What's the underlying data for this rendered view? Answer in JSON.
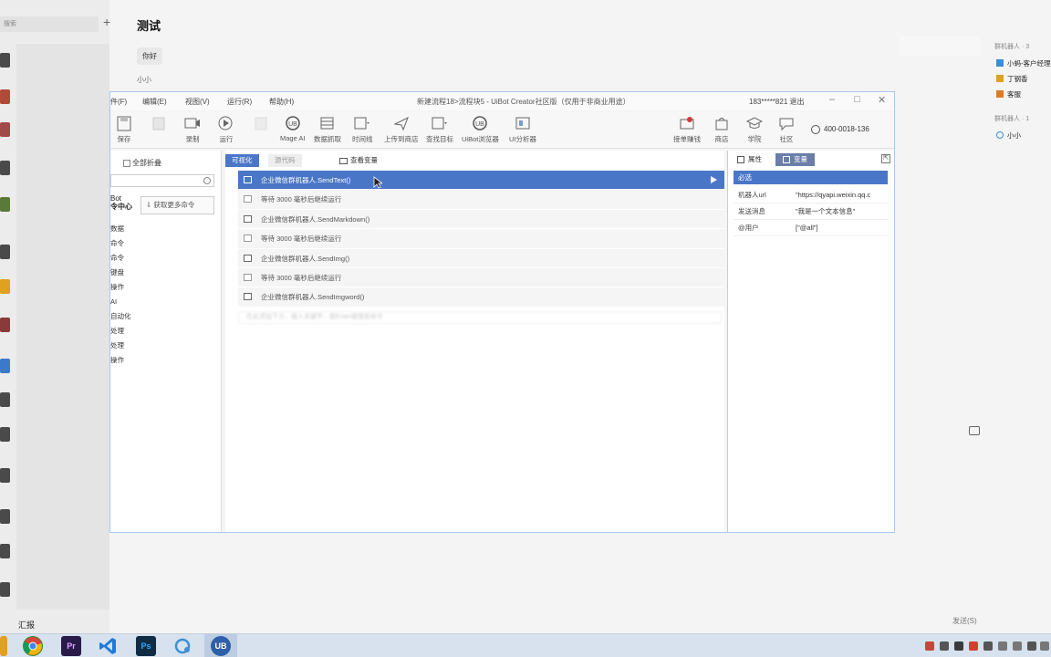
{
  "chat": {
    "search_placeholder": "搜索",
    "title": "测试",
    "bubble": "你好",
    "sender": "小小",
    "report": "汇报",
    "send": "发送(S)",
    "right_list": {
      "bots_header": "群机器人 · 3",
      "bots": [
        "小蚂-客户经理",
        "丁钢香",
        "客服"
      ],
      "people_header": "群机器人 · 1",
      "people": [
        "小小"
      ]
    }
  },
  "uibot": {
    "menus": [
      "件(F)",
      "编辑(E)",
      "视图(V)",
      "运行(R)",
      "帮助(H)"
    ],
    "window_title": "新建流程18>流程块5 - UiBot Creator社区版（仅用于非商业用途）",
    "user": "183*****821  退出",
    "toolbar": [
      {
        "label": "保存",
        "icon": "save-icon"
      },
      {
        "label": "",
        "icon": "disabled-icon"
      },
      {
        "label": "录制",
        "icon": "record-icon"
      },
      {
        "label": "运行",
        "icon": "run-icon"
      },
      {
        "label": "",
        "icon": "disabled-icon"
      },
      {
        "label": "Mage AI",
        "icon": "mage-ai-icon"
      },
      {
        "label": "数据抓取",
        "icon": "data-scrape-icon"
      },
      {
        "label": "时间线",
        "icon": "timeline-icon"
      },
      {
        "label": "上传到商店",
        "icon": "upload-icon"
      },
      {
        "label": "查找目标",
        "icon": "find-target-icon"
      },
      {
        "label": "UiBot浏览器",
        "icon": "uibot-browser-icon"
      },
      {
        "label": "UI分析器",
        "icon": "ui-analyzer-icon"
      }
    ],
    "toolbar_right": [
      {
        "label": "接单赚钱",
        "icon": "earn-icon"
      },
      {
        "label": "商店",
        "icon": "store-icon"
      },
      {
        "label": "学院",
        "icon": "academy-icon"
      },
      {
        "label": "社区",
        "icon": "community-icon"
      }
    ],
    "phone": "400-0018-136",
    "cmd_panel": {
      "collapse_all": "全部折叠",
      "bot_label_1": "Bot",
      "bot_label_2": "令中心",
      "get_more": "获取更多命令",
      "items": [
        "数据",
        "命令",
        "命令",
        "键盘",
        "操作",
        "AI",
        "自动化",
        "处理",
        "处理",
        "操作"
      ]
    },
    "tabs": {
      "visual": "可视化",
      "source": "源代码",
      "vars": "查看变量"
    },
    "steps": [
      {
        "text": "企业微信群机器人.SendText()",
        "type": "cmd",
        "selected": true
      },
      {
        "text": "等待 3000 毫秒后继续运行",
        "type": "wait",
        "selected": false
      },
      {
        "text": "企业微信群机器人.SendMarkdown()",
        "type": "cmd",
        "selected": false
      },
      {
        "text": "等待 3000 毫秒后继续运行",
        "type": "wait",
        "selected": false
      },
      {
        "text": "企业微信群机器人.SendImg()",
        "type": "cmd",
        "selected": false
      },
      {
        "text": "等待 3000 毫秒后继续运行",
        "type": "wait",
        "selected": false
      },
      {
        "text": "企业微信群机器人.SendImgword()",
        "type": "cmd",
        "selected": false
      }
    ],
    "add_hint": "在此添加下方，输入关键字，按Enter键搜索命令",
    "props": {
      "tab_attr": "属性",
      "tab_var": "变量",
      "required": "必选",
      "rows": [
        {
          "key": "机器人url",
          "value": "\"https://qyapi.weixin.qq.c"
        },
        {
          "key": "发送消息",
          "value": "\"我是一个文本信息\""
        },
        {
          "key": "@用户",
          "value": "[\"@all\"]"
        }
      ]
    }
  },
  "taskbar": {
    "apps": [
      {
        "name": "chrome",
        "label": "",
        "color": "#2f8f3f"
      },
      {
        "name": "premiere",
        "label": "Pr",
        "color": "#2a1a4a"
      },
      {
        "name": "vscode",
        "label": "",
        "color": "#1f6fbf"
      },
      {
        "name": "photoshop",
        "label": "Ps",
        "color": "#0f2c44"
      },
      {
        "name": "chat-app",
        "label": "",
        "color": "#3d8fd6"
      },
      {
        "name": "uibot",
        "label": "UB",
        "color": "#2f5fa8"
      }
    ]
  }
}
